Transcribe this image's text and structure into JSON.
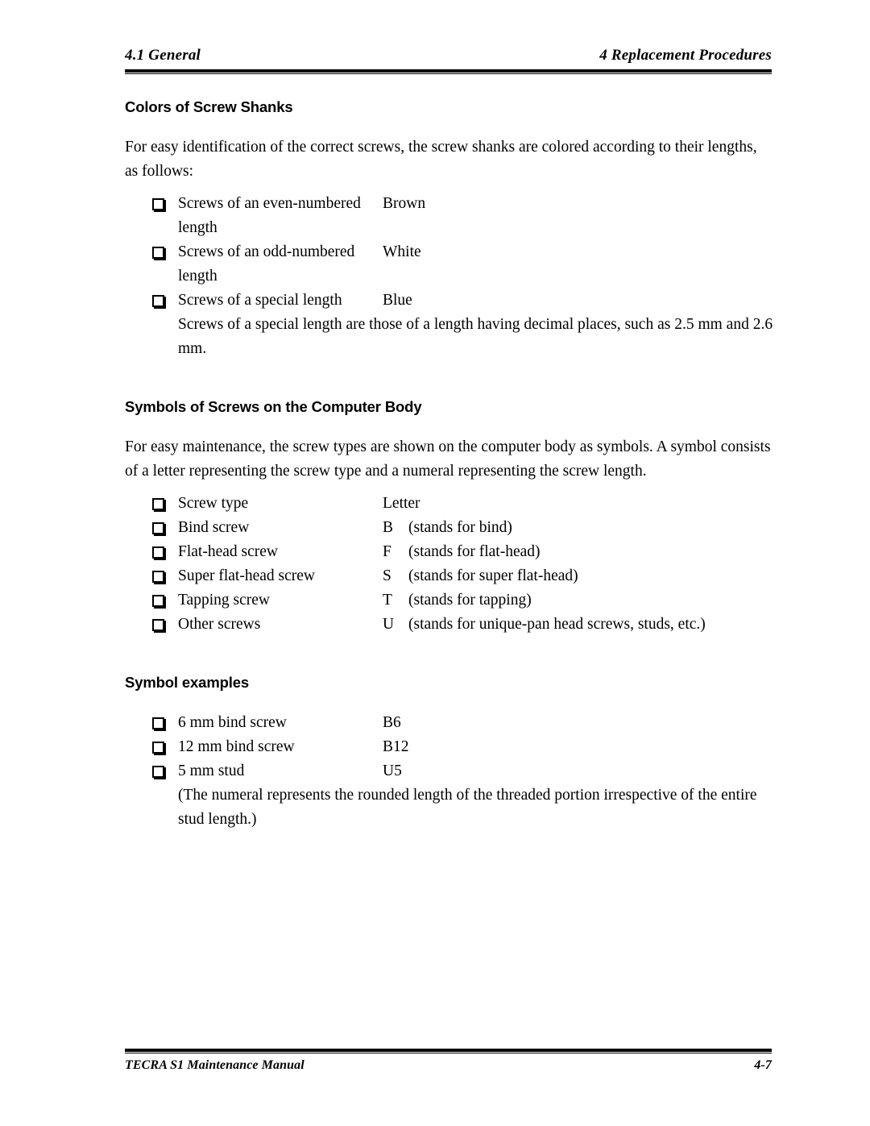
{
  "header": {
    "left": "4.1  General",
    "right": "4  Replacement Procedures"
  },
  "footer": {
    "left": "TECRA S1 Maintenance Manual",
    "right": "4-7"
  },
  "sections": [
    {
      "heading": "Colors of Screw Shanks",
      "paragraph": "For easy identification of the correct screws, the screw shanks are colored according to their lengths, as follows:",
      "items": [
        {
          "label": "Screws of an even-numbered length",
          "value": "Brown"
        },
        {
          "label": "Screws of an odd-numbered length",
          "value": "White"
        },
        {
          "label": "Screws of a special length",
          "value": "Blue"
        }
      ],
      "continuation": "Screws of a special length are those of a length having decimal places, such as 2.5 mm and 2.6 mm."
    },
    {
      "heading": "Symbols of Screws on the Computer Body",
      "paragraph": "For easy maintenance, the screw types are shown on the computer body as symbols. A symbol consists of a letter representing the screw type and a numeral representing the screw length.",
      "items": [
        {
          "label": "Screw type",
          "value": "Letter",
          "note": ""
        },
        {
          "label": "Bind screw",
          "value": "B",
          "note": "(stands for bind)"
        },
        {
          "label": "Flat-head screw",
          "value": "F",
          "note": "(stands for flat-head)"
        },
        {
          "label": "Super flat-head screw",
          "value": "S",
          "note": "(stands for super flat-head)"
        },
        {
          "label": "Tapping screw",
          "value": "T",
          "note": "(stands for tapping)"
        },
        {
          "label": "Other screws",
          "value": "U",
          "note": "(stands for unique-pan head screws, studs, etc.)"
        }
      ]
    },
    {
      "heading": "Symbol examples",
      "items": [
        {
          "label": "6 mm bind screw",
          "value": "B6"
        },
        {
          "label": "12 mm bind screw",
          "value": "B12"
        },
        {
          "label": "5 mm stud",
          "value": "U5"
        }
      ],
      "continuation": "(The numeral represents the rounded length of the threaded portion irrespective of the entire stud length.)"
    }
  ],
  "icons": {
    "bullet": "hollow-square-bullet"
  }
}
